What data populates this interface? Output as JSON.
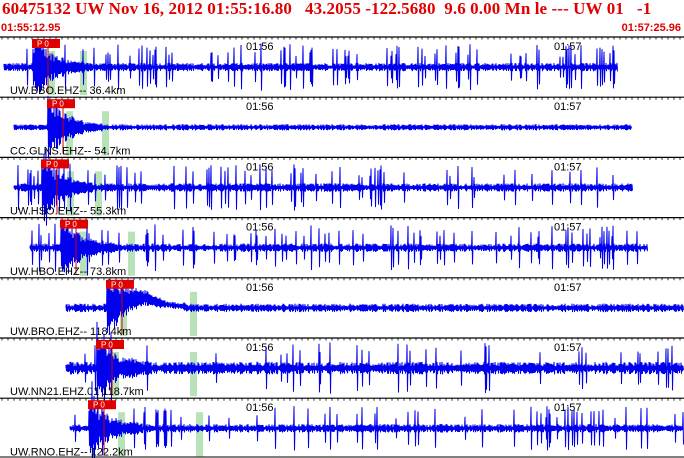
{
  "event": {
    "header": "60475132 UW Nov 16, 2012 01:55:16.80   43.2055 -122.5680  9.6 0.00 Mn le --- UW 01   -1",
    "start_time": "01:55:12.95",
    "end_time": "01:57:25.96"
  },
  "minute_labels": [
    "01:56",
    "01:57"
  ],
  "colors": {
    "trace": "#0000ee",
    "pick_flag": "#e00000",
    "pick_line": "#cc0000",
    "window_highlight": "#b8e2b8",
    "separator": "#000000",
    "text": "#000000",
    "header_text": "#e00000"
  },
  "traces": [
    {
      "label": "UW.BBO.EHZ-- 36.4km",
      "pick_label": "P 0",
      "pick_time_s": 4,
      "windows_s": [
        6,
        11
      ],
      "style": "burst"
    },
    {
      "label": "CC.GLNS.EHZ-- 54.7km",
      "pick_label": "P 0",
      "pick_time_s": 7,
      "windows_s": [
        8,
        12
      ],
      "style": "quiet"
    },
    {
      "label": "UW.HSO.EHZ-- 55.3km",
      "pick_label": "P 0",
      "pick_time_s": 7,
      "windows_s": [
        9,
        12
      ],
      "style": "burst"
    },
    {
      "label": "UW.HBO.EHZ-- 73.8km",
      "pick_label": "P 0",
      "pick_time_s": 9,
      "windows_s": [
        12,
        16
      ],
      "style": "burst"
    },
    {
      "label": "UW.BRO.EHZ-- 118.4km",
      "pick_label": "P 0",
      "pick_time_s": 15,
      "windows_s": [
        17,
        28
      ],
      "style": "swell"
    },
    {
      "label": "UW.NN21.EHZ.01 118.7km",
      "pick_label": "P 0",
      "pick_time_s": 13,
      "windows_s": [
        16,
        29
      ],
      "style": "noisy"
    },
    {
      "label": "UW.RNO.EHZ-- 122.2km",
      "pick_label": "P 0",
      "pick_time_s": 12,
      "windows_s": [
        16,
        29
      ],
      "style": "spiky"
    }
  ]
}
